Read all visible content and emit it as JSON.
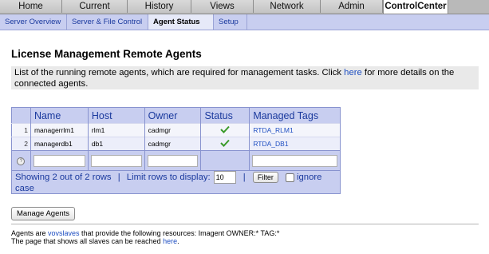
{
  "tabs": [
    {
      "label": "Home"
    },
    {
      "label": "Current"
    },
    {
      "label": "History"
    },
    {
      "label": "Views"
    },
    {
      "label": "Network"
    },
    {
      "label": "Admin"
    },
    {
      "label": "ControlCenter",
      "active": true
    }
  ],
  "subnav": [
    {
      "label": "Server Overview"
    },
    {
      "label": "Server & File Control"
    },
    {
      "label": "Agent Status",
      "active": true
    },
    {
      "label": "Setup"
    }
  ],
  "page": {
    "title": "License Management Remote Agents",
    "desc_before": "List of the running remote agents, which are required for management tasks. Click ",
    "desc_link": "here",
    "desc_after": " for more details on the connected agents."
  },
  "table": {
    "columns": [
      "Name",
      "Host",
      "Owner",
      "Status",
      "Managed Tags"
    ],
    "rows": [
      {
        "num": "1",
        "name": "managerrlm1",
        "host": "rlm1",
        "owner": "cadmgr",
        "status_icon": "check-icon",
        "tag": "RTDA_RLM1"
      },
      {
        "num": "2",
        "name": "managerdb1",
        "host": "db1",
        "owner": "cadmgr",
        "status_icon": "check-icon",
        "tag": "RTDA_DB1"
      }
    ],
    "help_glyph": "?",
    "footer": {
      "showing": "Showing 2 out of 2 rows",
      "sep1": "|",
      "limit_label": "Limit rows to display:",
      "limit_value": "10",
      "sep2": "|",
      "filter_button": "Filter",
      "ignore_case": "ignore case"
    }
  },
  "manage_button": "Manage Agents",
  "footer": {
    "line1_before": "Agents are ",
    "line1_link": "vovslaves",
    "line1_after": " that provide the following resources: Imagent OWNER:* TAG:*",
    "line2_before": "The page that shows all slaves can be reached ",
    "line2_link": "here",
    "line2_after": "."
  }
}
